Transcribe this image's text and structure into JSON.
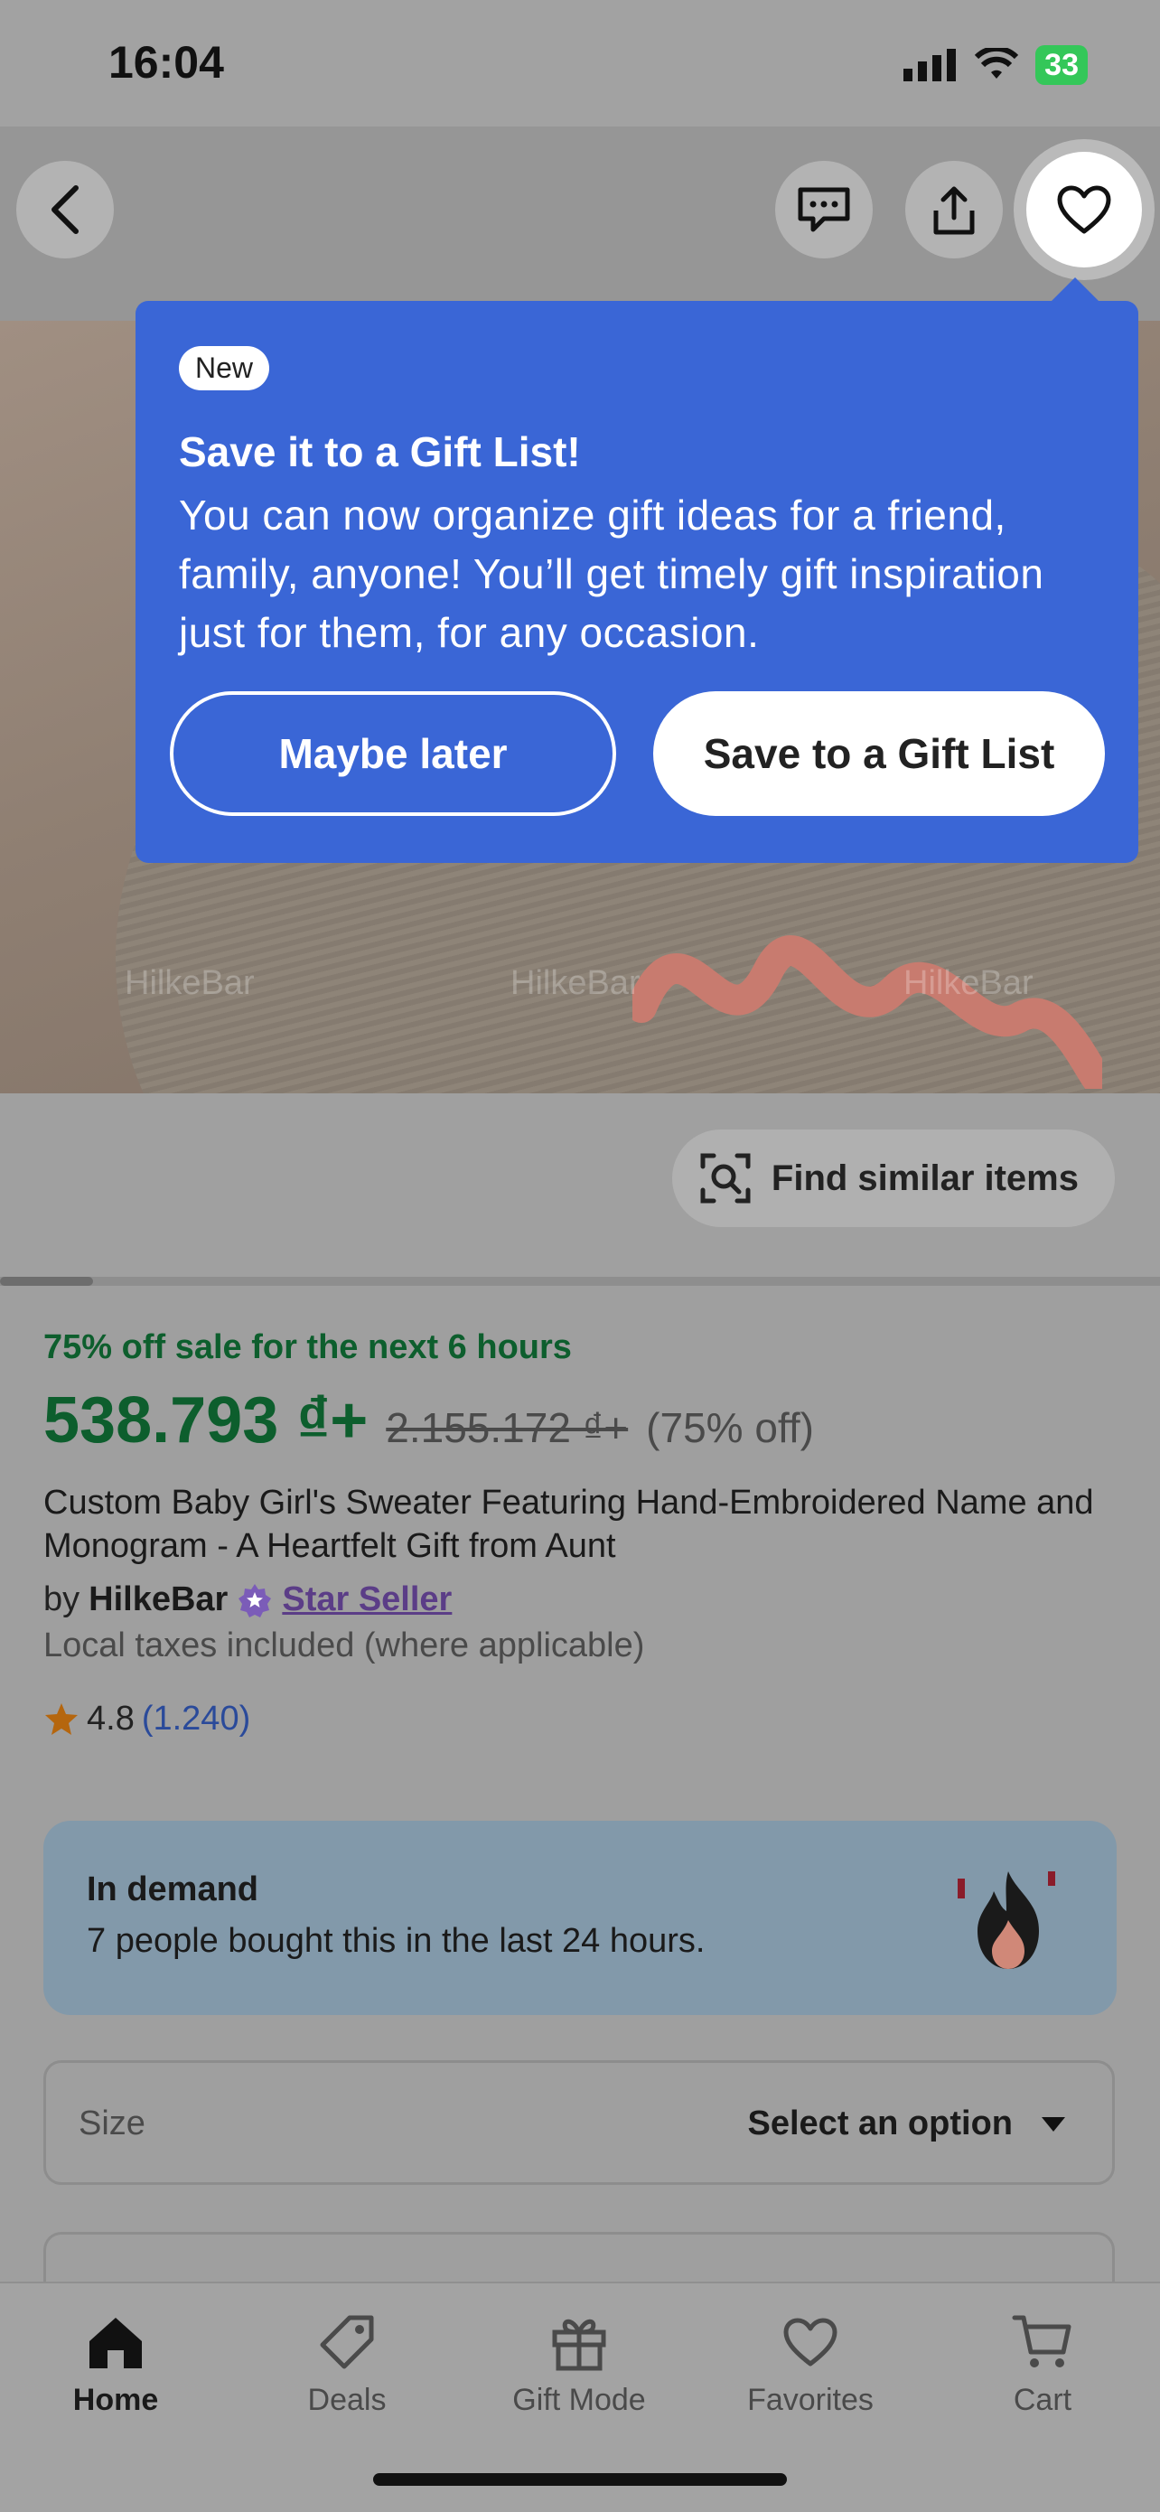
{
  "status_bar": {
    "time": "16:04",
    "battery": "33"
  },
  "popover": {
    "badge": "New",
    "title": "Save it to a Gift List!",
    "body": "You can now organize gift ideas for a friend, family, anyone! You’ll get timely gift inspiration just for them, for any occasion.",
    "secondary_button": "Maybe later",
    "primary_button": "Save to a Gift List"
  },
  "image_watermarks": [
    "HilkeBar",
    "HilkeBar",
    "HilkeBar"
  ],
  "find_similar": "Find similar items",
  "image_progress": 0.08,
  "listing": {
    "sale_text": "75% off sale for the next 6 hours",
    "price": "538.793 ₫+",
    "original_price": "2.155.172 ₫+",
    "discount": "(75% off)",
    "title": "Custom Baby Girl's Sweater Featuring Hand-Embroidered Name and Monogram - A Heartfelt Gift from Aunt",
    "by": "by",
    "seller": "HilkeBar",
    "seller_badge": "Star Seller",
    "taxes": "Local taxes included (where applicable)",
    "rating": "4.8",
    "rating_count": "(1.240)"
  },
  "demand": {
    "title": "In demand",
    "text": "7 people bought this in the last 24 hours."
  },
  "size_select": {
    "label": "Size",
    "value": "Select an option"
  },
  "tabbar": {
    "home": "Home",
    "deals": "Deals",
    "gift_mode": "Gift Mode",
    "favorites": "Favorites",
    "cart": "Cart"
  },
  "colors": {
    "accent_blue": "#3a66d6",
    "price_green": "#0d5e2d",
    "star_seller_purple": "#5b3d87"
  }
}
